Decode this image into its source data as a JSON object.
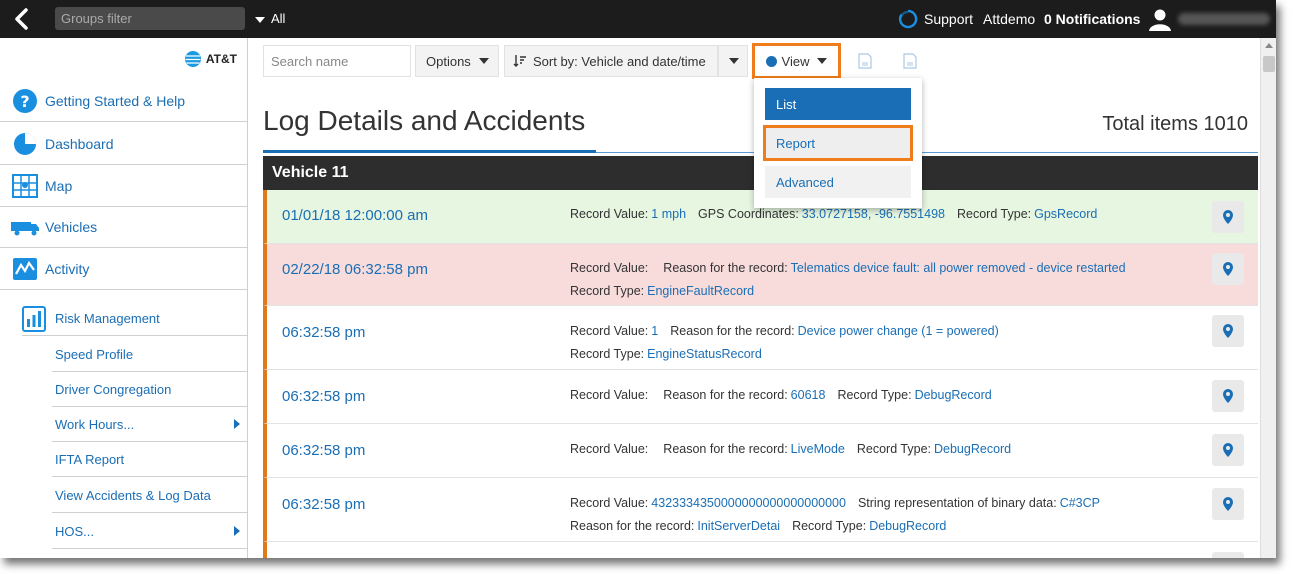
{
  "topbar": {
    "groups_placeholder": "Groups filter",
    "groups_value": "All",
    "support": "Support",
    "account": "Attdemo",
    "notifications": "0 Notifications"
  },
  "sidebar": {
    "logo_text": "AT&T",
    "items": [
      {
        "label": "Getting Started & Help",
        "icon": "help-icon"
      },
      {
        "label": "Dashboard",
        "icon": "pie-chart-icon"
      },
      {
        "label": "Map",
        "icon": "map-icon"
      },
      {
        "label": "Vehicles",
        "icon": "truck-icon"
      },
      {
        "label": "Activity",
        "icon": "activity-chart-icon"
      }
    ],
    "risk_management": "Risk Management",
    "sub_items": [
      {
        "label": "Speed Profile"
      },
      {
        "label": "Driver Congregation"
      },
      {
        "label": "Work Hours...",
        "submenu": true
      },
      {
        "label": "IFTA Report"
      },
      {
        "label": "View Accidents & Log Data"
      },
      {
        "label": "HOS...",
        "submenu": true
      }
    ]
  },
  "toolbar": {
    "search_placeholder": "Search name",
    "options_label": "Options",
    "sort_label": "Sort by: Vehicle and date/time",
    "view_label": "View"
  },
  "view_menu": {
    "list": "List",
    "report": "Report",
    "advanced": "Advanced"
  },
  "page": {
    "title": "Log Details and Accidents",
    "total": "Total items 1010"
  },
  "vehicle": "Vehicle 11",
  "rows": [
    {
      "time": "01/01/18 12:00:00 am",
      "status": "ok",
      "line1": [
        {
          "label": "Record Value:",
          "value": "1 mph"
        },
        {
          "label": "GPS Coordinates:",
          "value": "33.0727158, -96.7551498"
        },
        {
          "label": "Record Type:",
          "value": "GpsRecord"
        }
      ],
      "line2": []
    },
    {
      "time": "02/22/18 06:32:58 pm",
      "status": "fault",
      "line1": [
        {
          "label": "Record Value:",
          "value": ""
        },
        {
          "label": "Reason for the record:",
          "value": "Telematics device fault: all power removed - device restarted"
        }
      ],
      "line2": [
        {
          "label": "Record Type:",
          "value": "EngineFaultRecord"
        }
      ]
    },
    {
      "time": "06:32:58 pm",
      "status": "normal",
      "line1": [
        {
          "label": "Record Value:",
          "value": "1"
        },
        {
          "label": "Reason for the record:",
          "value": "Device power change (1 = powered)"
        }
      ],
      "line2": [
        {
          "label": "Record Type:",
          "value": "EngineStatusRecord"
        }
      ]
    },
    {
      "time": "06:32:58 pm",
      "status": "normal",
      "line1": [
        {
          "label": "Record Value:",
          "value": ""
        },
        {
          "label": "Reason for the record:",
          "value": "60618"
        },
        {
          "label": "Record Type:",
          "value": "DebugRecord"
        }
      ],
      "line2": []
    },
    {
      "time": "06:32:58 pm",
      "status": "normal",
      "line1": [
        {
          "label": "Record Value:",
          "value": ""
        },
        {
          "label": "Reason for the record:",
          "value": "LiveMode"
        },
        {
          "label": "Record Type:",
          "value": "DebugRecord"
        }
      ],
      "line2": []
    },
    {
      "time": "06:32:58 pm",
      "status": "normal",
      "line1": [
        {
          "label": "Record Value:",
          "value": "4323334350000000000000000000"
        },
        {
          "label": "String representation of binary data:",
          "value": "C#3CP"
        }
      ],
      "line2": [
        {
          "label": "Reason for the record:",
          "value": "InitServerDetai"
        },
        {
          "label": "Record Type:",
          "value": "DebugRecord"
        }
      ]
    }
  ],
  "colors": {
    "accent_blue": "#1a6eb5",
    "highlight_orange": "#f07d1b",
    "row_ok_bg": "#e6f6e1",
    "row_fault_bg": "#f8dcdc",
    "topbar_bg": "#1c1c1c"
  }
}
